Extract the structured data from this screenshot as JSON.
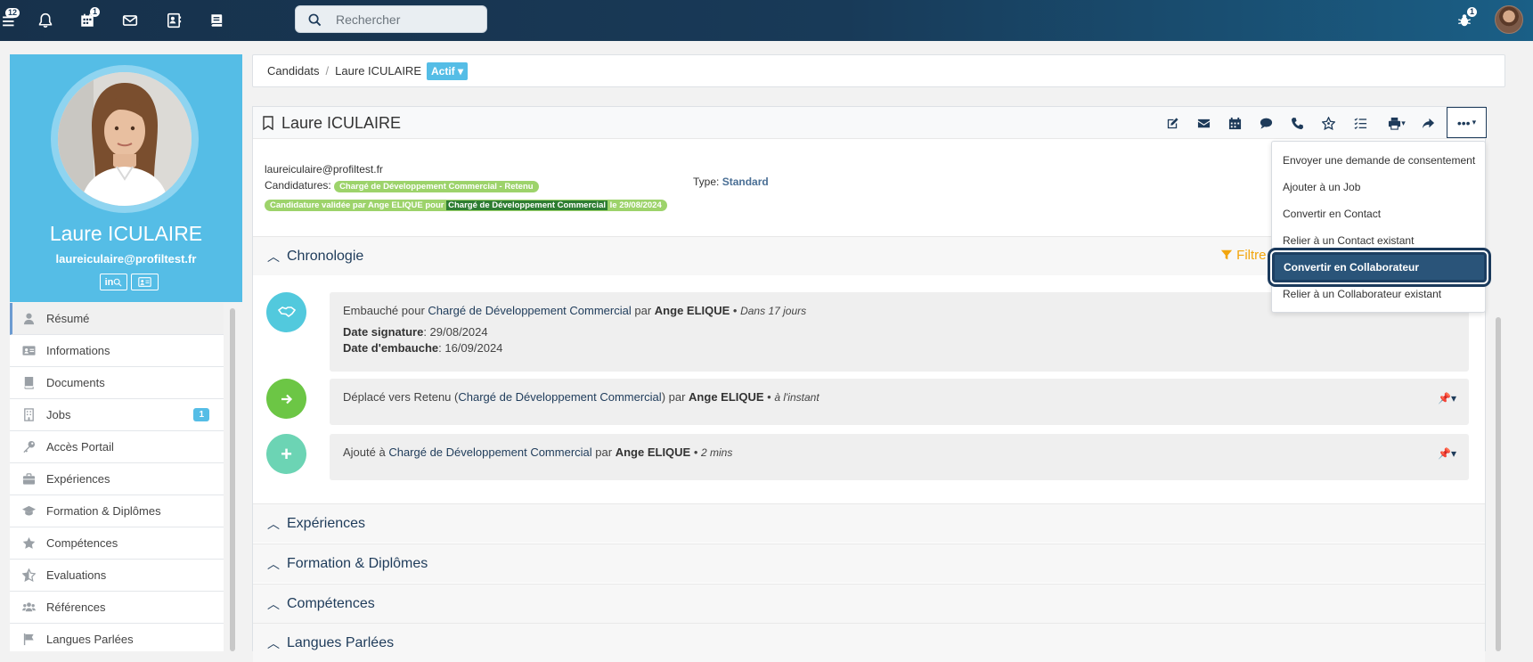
{
  "topbar": {
    "menu_badge": "12",
    "calendar_badge": "1",
    "bug_badge": "1",
    "search_placeholder": "Rechercher"
  },
  "profile": {
    "name": "Laure ICULAIRE",
    "email": "laureiculaire@profiltest.fr",
    "links": [
      "in",
      "card"
    ]
  },
  "sidebar": {
    "items": [
      {
        "label": "Résumé",
        "icon": "person-icon"
      },
      {
        "label": "Informations",
        "icon": "id-card-icon"
      },
      {
        "label": "Documents",
        "icon": "book-icon"
      },
      {
        "label": "Jobs",
        "icon": "building-icon",
        "badge": "1"
      },
      {
        "label": "Accès Portail",
        "icon": "key-icon"
      },
      {
        "label": "Expériences",
        "icon": "briefcase-icon"
      },
      {
        "label": "Formation & Diplômes",
        "icon": "graduation-cap-icon"
      },
      {
        "label": "Compétences",
        "icon": "star-icon"
      },
      {
        "label": "Evaluations",
        "icon": "star-half-icon"
      },
      {
        "label": "Références",
        "icon": "users-icon"
      },
      {
        "label": "Langues Parlées",
        "icon": "flag-icon"
      }
    ]
  },
  "breadcrumb": {
    "parent": "Candidats",
    "current": "Laure ICULAIRE",
    "status": "Actif"
  },
  "card": {
    "title": "Laure ICULAIRE",
    "email": "laureiculaire@profiltest.fr",
    "candidatures_label": "Candidatures:",
    "candidature_pill": "Chargé de Développement Commercial - Retenu",
    "validation_prefix": "Candidature validée par Ange ELIQUE pour",
    "validation_job": "Chargé de Développement Commercial",
    "validation_suffix": "le 29/08/2024",
    "type_label": "Type:",
    "type_value": "Standard",
    "filter_label": "Filtre"
  },
  "sections": {
    "chronologie": "Chronologie",
    "experiences": "Expériences",
    "formation": "Formation & Diplômes",
    "competences": "Compétences",
    "langues": "Langues Parlées"
  },
  "timeline": [
    {
      "prefix": "Embauché pour",
      "job": "Chargé de Développement Commercial",
      "by": "par",
      "author": "Ange ELIQUE",
      "time": "Dans 17 jours",
      "date_sig_label": "Date signature",
      "date_sig": ": 29/08/2024",
      "date_emb_label": "Date d'embauche",
      "date_emb": ": 16/09/2024"
    },
    {
      "prefix": "Déplacé vers Retenu (",
      "job": "Chargé de Développement Commercial",
      "suffix": ") par",
      "author": "Ange ELIQUE",
      "time": "à l'instant"
    },
    {
      "prefix": "Ajouté à",
      "job": "Chargé de Développement Commercial",
      "by": "par",
      "author": "Ange ELIQUE",
      "time": "2 mins"
    }
  ],
  "dropdown": {
    "items": [
      "Envoyer une demande de consentement",
      "Ajouter à un Job",
      "Convertir en Contact",
      "Relier à un Contact existant",
      "Convertir en Collaborateur",
      "Relier à un Collaborateur existant"
    ]
  },
  "colors": {
    "topbar": "#17314b",
    "accent": "#55bde6",
    "navy": "#1e3b5a",
    "green_pill": "#9dd36b",
    "filter": "#f2a50c"
  }
}
